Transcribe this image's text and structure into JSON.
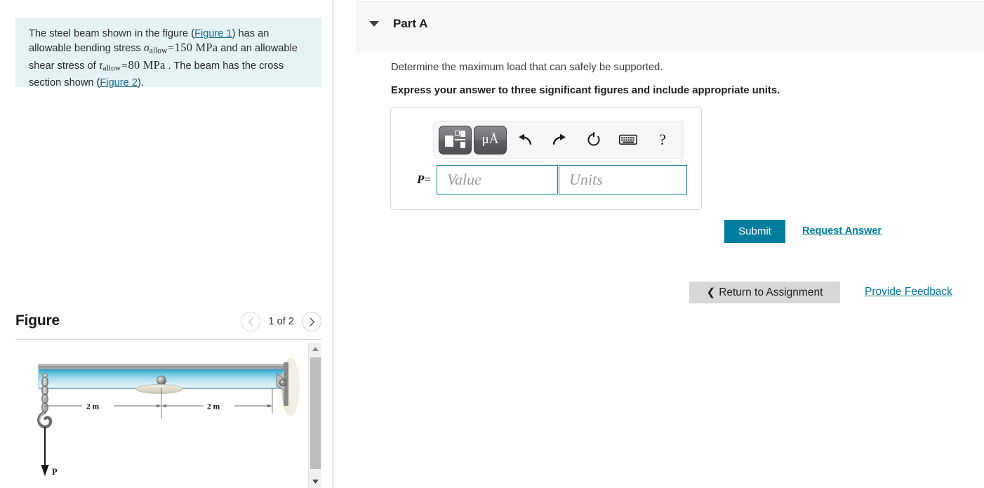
{
  "problem": {
    "segments": [
      {
        "t": "text",
        "v": "The steel beam shown in the figure ("
      },
      {
        "t": "link",
        "v": "Figure 1"
      },
      {
        "t": "text",
        "v": ") has an allowable bending stress "
      },
      {
        "t": "mathvar",
        "v": "σ"
      },
      {
        "t": "mathsub",
        "v": "allow"
      },
      {
        "t": "mathop",
        "v": "="
      },
      {
        "t": "mathnum",
        "v": "150 MPa"
      },
      {
        "t": "text",
        "v": " and an allowable shear stress of "
      },
      {
        "t": "mathvar",
        "v": "τ"
      },
      {
        "t": "mathsub",
        "v": "allow"
      },
      {
        "t": "mathop",
        "v": "="
      },
      {
        "t": "mathnum",
        "v": "80 MPa"
      },
      {
        "t": "text",
        "v": " . The beam has the cross section shown ("
      },
      {
        "t": "link",
        "v": "Figure 2"
      },
      {
        "t": "text",
        "v": ")."
      }
    ],
    "full_text": "The steel beam shown in the figure (Figure 1) has an allowable bending stress σallow = 150 MPa and an allowable shear stress of τallow = 80 MPa . The beam has the cross section shown (Figure 2).",
    "figure1_link": "Figure 1",
    "figure2_link": "Figure 2",
    "sigma_symbol": "σ",
    "tau_symbol": "τ",
    "subscript": "allow",
    "equals": "=",
    "bending_value": "150 MPa",
    "shear_value": "80 MPa",
    "background_color": "#e4f2f4"
  },
  "figure_panel": {
    "title": "Figure",
    "pager": {
      "prev_label": "‹",
      "count_label": "1 of 2",
      "next_label": "›",
      "prev_disabled": true,
      "current": 1,
      "total": 2
    },
    "scrollbar": {
      "up_arrow": "▲",
      "down_arrow": "▼"
    },
    "diagram": {
      "name": "cantilever-beam-with-hook-load",
      "dim_left_label": "2 m",
      "dim_right_label": "2 m",
      "load_label": "P",
      "beam_color": "#5cc3e0",
      "beam_top_color": "#9a9a9a",
      "wall_color": "#e6e4d3"
    }
  },
  "part": {
    "caret_icon": "caret-down-icon",
    "label": "Part A",
    "prompt": "Determine the maximum load that can safely be supported.",
    "instruction": "Express your answer to three significant figures and include appropriate units."
  },
  "answer": {
    "toolbar": [
      {
        "name": "math-template-button",
        "icon": "template-icon",
        "label": ""
      },
      {
        "name": "units-button",
        "icon": "micro-angstrom-icon",
        "label": "μÅ"
      },
      {
        "name": "undo-button",
        "icon": "undo-arrow-icon",
        "label": "↰"
      },
      {
        "name": "redo-button",
        "icon": "redo-arrow-icon",
        "label": "↱"
      },
      {
        "name": "reset-button",
        "icon": "refresh-circle-icon",
        "label": "↻"
      },
      {
        "name": "keyboard-button",
        "icon": "keyboard-icon",
        "label": "⌨"
      },
      {
        "name": "help-button",
        "icon": "question-mark-icon",
        "label": "?"
      }
    ],
    "equation_label": "P",
    "equation_equals": "=",
    "value_placeholder": "Value",
    "value_text": "",
    "units_placeholder": "Units",
    "units_text": "",
    "input_border_color": "#1a7d96"
  },
  "actions": {
    "submit_label": "Submit",
    "submit_color": "#007d9e",
    "request_answer_label": "Request Answer",
    "return_label": "Return to Assignment",
    "return_chevron": "❮",
    "feedback_label": "Provide Feedback",
    "link_color": "#0b6f94"
  }
}
